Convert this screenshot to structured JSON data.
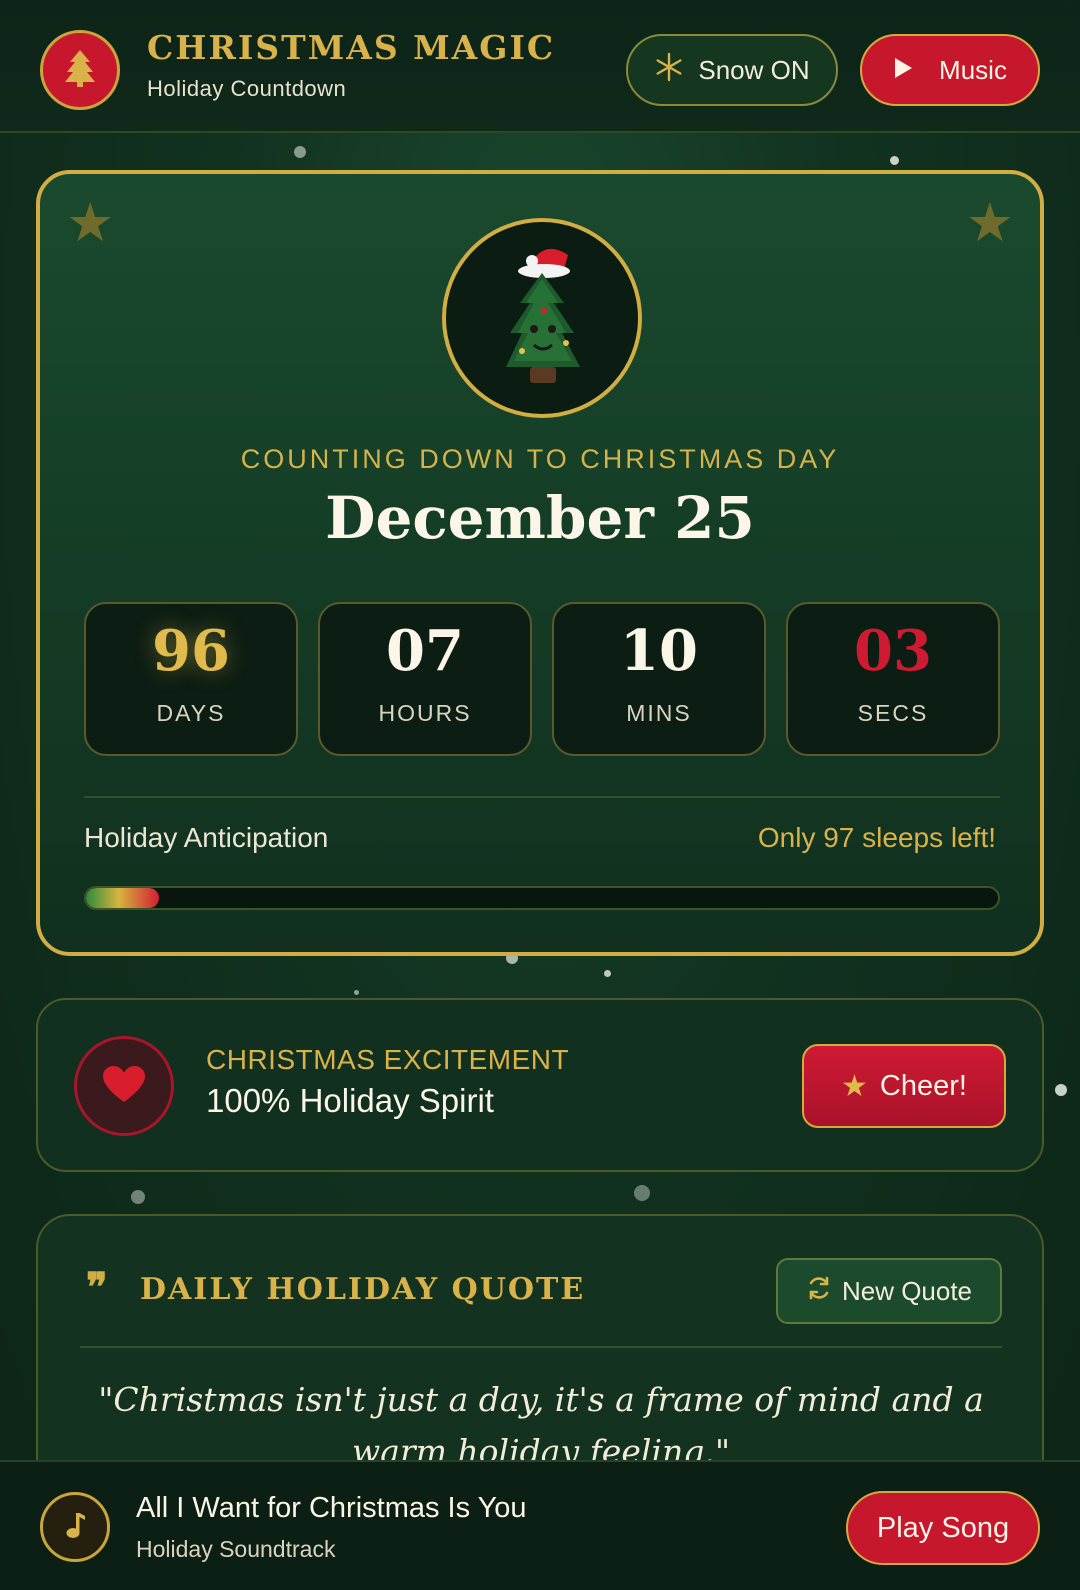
{
  "header": {
    "title": "CHRISTMAS MAGIC",
    "subtitle": "Holiday Countdown",
    "snow_button_label": "Snow ON",
    "music_button_label": "Music"
  },
  "countdown": {
    "label": "COUNTING DOWN TO CHRISTMAS DAY",
    "target_date": "December 25",
    "days": {
      "value": "96",
      "unit": "DAYS"
    },
    "hours": {
      "value": "07",
      "unit": "HOURS"
    },
    "mins": {
      "value": "10",
      "unit": "MINS"
    },
    "secs": {
      "value": "03",
      "unit": "SECS"
    },
    "anticipation_label": "Holiday Anticipation",
    "sleeps_label": "Only 97 sleeps left!",
    "progress_fraction": 0.08
  },
  "excitement": {
    "label": "CHRISTMAS EXCITEMENT",
    "value": "100% Holiday Spirit",
    "cheer_button_label": "Cheer!"
  },
  "quote": {
    "title": "DAILY HOLIDAY QUOTE",
    "new_quote_label": "New Quote",
    "text": "\"Christmas isn't just a day, it's a frame of mind and a warm holiday feeling.\""
  },
  "music_bar": {
    "song_title": "All I Want for Christmas Is You",
    "song_subtitle": "Holiday Soundtrack",
    "play_button_label": "Play Song"
  },
  "colors": {
    "accent_gold": "#d2ad43",
    "accent_red": "#c7172d",
    "background_green": "#123321"
  },
  "icons": {
    "logo": "tree-icon",
    "snow": "snowflake-icon",
    "music": "play-icon",
    "excitement": "heart-icon",
    "cheer": "star-icon",
    "quote": "quote-icon",
    "new_quote": "refresh-icon",
    "music_bar": "music-note-icon"
  }
}
